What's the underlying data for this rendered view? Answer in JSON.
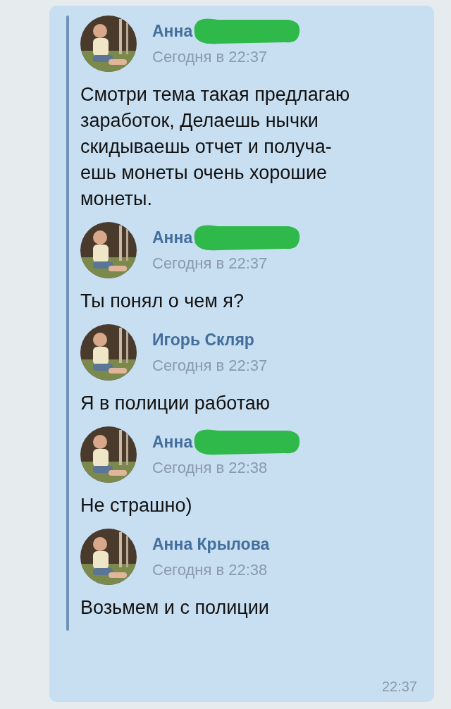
{
  "messages": [
    {
      "author": "Анна",
      "redacted": true,
      "time": "Сегодня в 22:37",
      "text": "Смотри тема такая предлагаю\nзаработок, Делаешь нычки\nскидываешь отчет и получа-\nешь монеты очень хорошие\nмонеты."
    },
    {
      "author": "Анна",
      "redacted": true,
      "time": "Сегодня в 22:37",
      "text": "Ты понял о чем я?"
    },
    {
      "author": "Игорь Скляр",
      "redacted": false,
      "time": "Сегодня в 22:37",
      "text": "Я в полиции работаю"
    },
    {
      "author": "Анна",
      "redacted": true,
      "time": "Сегодня в 22:38",
      "text": "Не страшно)"
    },
    {
      "author": "Анна Крылова",
      "redacted": false,
      "time": "Сегодня в 22:38",
      "text": "Возьмем и с полиции"
    }
  ],
  "sent_time": "22:37"
}
